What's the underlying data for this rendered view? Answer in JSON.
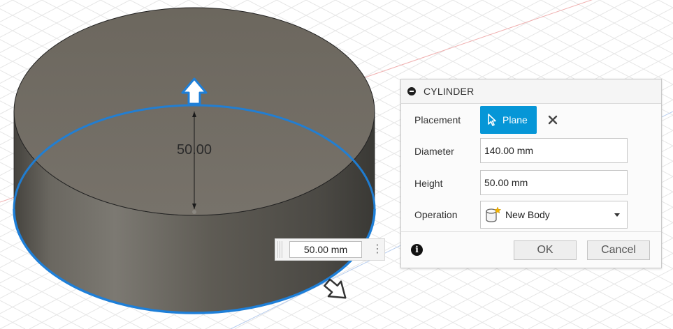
{
  "viewport": {
    "dimension_label": "50.00",
    "colors": {
      "selection_blue": "#1e7fd8",
      "body_top": "#6f6a62",
      "body_side": "#5d5a53",
      "grid_line": "#e6e6e6",
      "axis_red": "#e88a8a",
      "axis_blue": "#8ab0e8"
    }
  },
  "float_input": {
    "value": "50.00 mm",
    "more_icon": "vertical-ellipsis-icon"
  },
  "dialog": {
    "title": "CYLINDER",
    "placement": {
      "label": "Placement",
      "button_label": "Plane"
    },
    "diameter": {
      "label": "Diameter",
      "value": "140.00 mm"
    },
    "height": {
      "label": "Height",
      "value": "50.00 mm"
    },
    "operation": {
      "label": "Operation",
      "value": "New Body"
    },
    "info_symbol": "i",
    "ok_label": "OK",
    "cancel_label": "Cancel",
    "accent_color": "#0696d7"
  }
}
